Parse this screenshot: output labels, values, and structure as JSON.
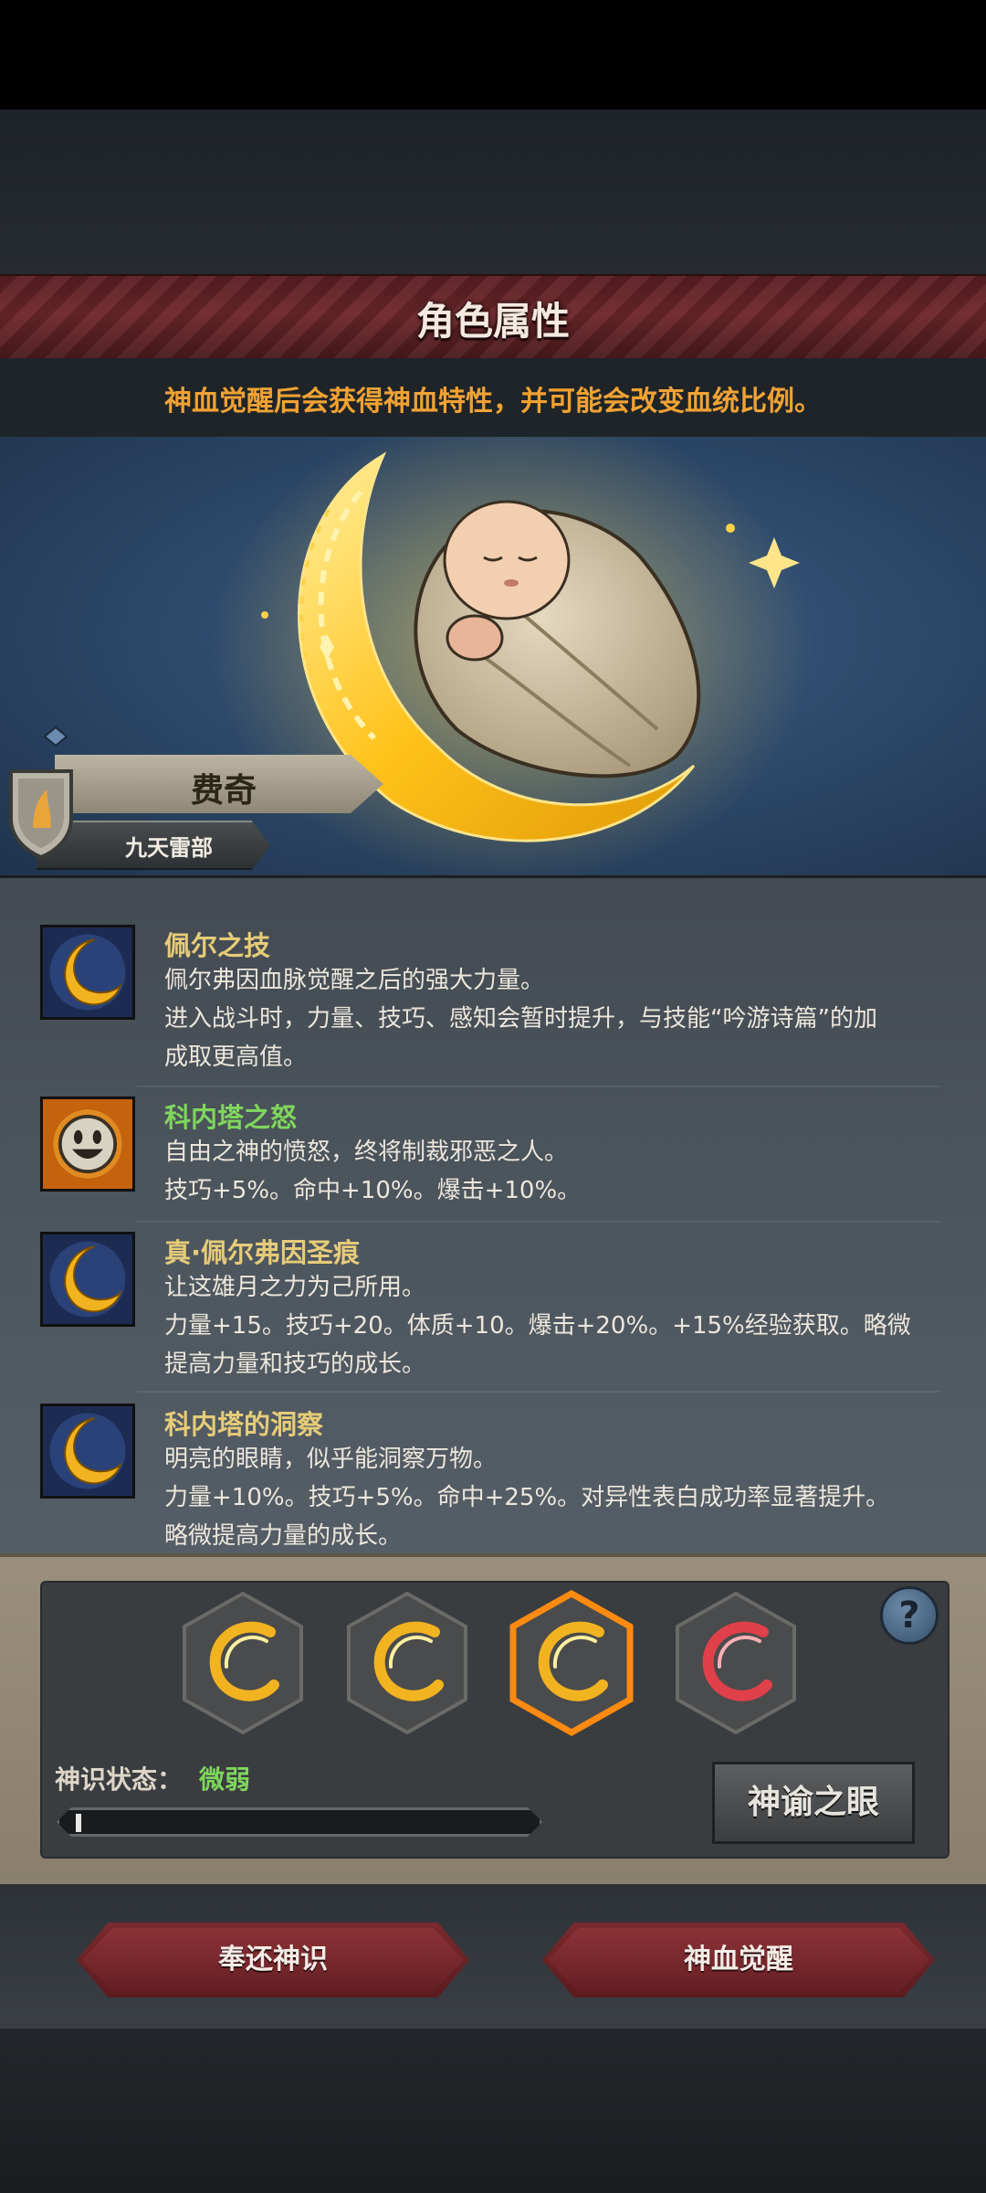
{
  "header": {
    "title": "角色属性",
    "subtitle": "神血觉醒后会获得神血特性，并可能会改变血统比例。"
  },
  "character": {
    "name": "费奇",
    "clan": "九天雷部"
  },
  "traits": [
    {
      "name": "佩尔之技",
      "icon": "crescent-moon-icon",
      "name_color": "#e6cc78",
      "lines": [
        "佩尔弗因血脉觉醒之后的强大力量。",
        "进入战斗时，力量、技巧、感知会暂时提升，与技能“吟游诗篇”的加",
        "成取更高值。"
      ]
    },
    {
      "name": "科内塔之怒",
      "icon": "smiley-face-icon",
      "name_color": "#7fd65c",
      "lines": [
        "自由之神的愤怒，终将制裁邪恶之人。",
        "技巧+5%。命中+10%。爆击+10%。"
      ]
    },
    {
      "name": "真·佩尔弗因圣痕",
      "icon": "crescent-moon-icon",
      "name_color": "#e6cc78",
      "lines": [
        "让这雄月之力为己所用。",
        "力量+15。技巧+20。体质+10。爆击+20%。+15%经验获取。略微",
        "提高力量和技巧的成长。"
      ]
    },
    {
      "name": "科内塔的洞察",
      "icon": "crescent-moon-icon",
      "name_color": "#e6cc78",
      "lines": [
        "明亮的眼睛，似乎能洞察万物。",
        "力量+10%。技巧+5%。命中+25%。对异性表白成功率显著提升。",
        "略微提高力量的成长。"
      ]
    }
  ],
  "blood_slots": [
    {
      "icon": "golden-crescent-icon",
      "color": "#f2b320",
      "selected": false
    },
    {
      "icon": "golden-crescent-icon",
      "color": "#f2b320",
      "selected": false
    },
    {
      "icon": "golden-crescent-icon",
      "color": "#f2b320",
      "selected": true
    },
    {
      "icon": "red-crescent-icon",
      "color": "#e0404a",
      "selected": false
    }
  ],
  "status": {
    "label": "神识状态：",
    "value": "微弱",
    "progress": 0.01
  },
  "buttons": {
    "oracle": "神谕之眼",
    "help": "?",
    "return": "奉还神识",
    "awaken": "神血觉醒"
  }
}
